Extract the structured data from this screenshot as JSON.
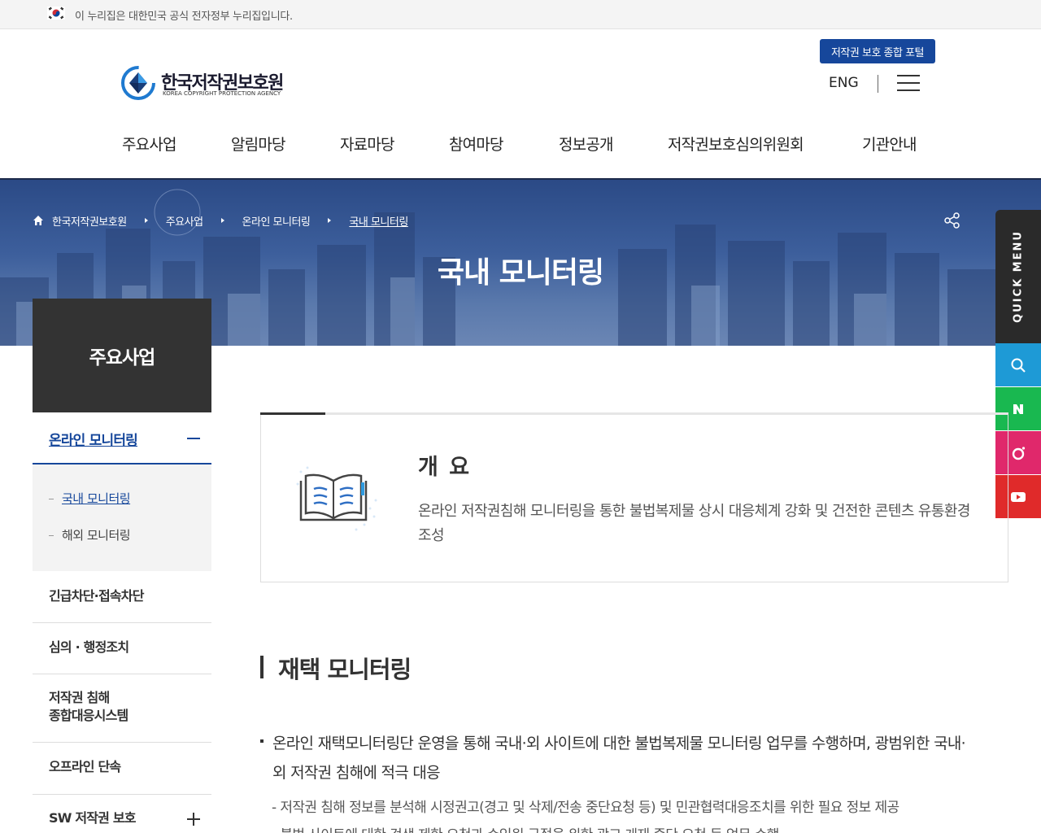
{
  "gov_banner": {
    "text": "이 누리집은 대한민국 공식 전자정부 누리집입니다."
  },
  "header": {
    "logo_kr": "한국저작권보호원",
    "logo_en": "KOREA COPYRIGHT PROTECTION AGENCY",
    "portal_button": "저작권 보호 종합 포털",
    "eng_link": "ENG"
  },
  "gnb": [
    "주요사업",
    "알림마당",
    "자료마당",
    "참여마당",
    "정보공개",
    "저작권보호심의위원회",
    "기관안내"
  ],
  "breadcrumb": [
    "한국저작권보호원",
    "주요사업",
    "온라인 모니터링",
    "국내 모니터링"
  ],
  "hero": {
    "title": "국내 모니터링"
  },
  "quick_menu": {
    "label": "QUICK MENU",
    "buttons": [
      "search-icon",
      "naver-blog-icon",
      "instagram-icon",
      "youtube-icon"
    ],
    "colors": [
      "#1e9ad6",
      "#19b850",
      "#e0286b",
      "#e02a2a"
    ]
  },
  "lnb": {
    "title": "주요사업",
    "active": "온라인 모니터링",
    "sub_items": [
      "국내 모니터링",
      "해외 모니터링"
    ],
    "items": [
      "긴급차단·접속차단",
      "심의 · 행정조치",
      "저작권 침해\n종합대응시스템",
      "오프라인 단속",
      "SW 저작권 보호"
    ]
  },
  "overview": {
    "title": "개 요",
    "desc": "온라인 저작권침해 모니터링을 통한 불법복제물 상시 대응체계 강화 및 건전한 콘텐츠 유통환경 조성"
  },
  "section": {
    "title": "재택 모니터링",
    "bullet": "온라인 재택모니터링단 운영을 통해 국내·외 사이트에 대한 불법복제물 모니터링 업무를 수행하며, 광범위한 국내·외 저작권 침해에 적극 대응",
    "sub1": "- 저작권 침해 정보를 분석해 시정권고(경고 및 삭제/전송 중단요청 등) 및 민관협력대응조치를 위한 필요 정보 제공",
    "sub2": "- 불법 사이트에 대한 검색 제한 요청과 수익원 근절을 위한 광고 게재 중단 요청 등 업무 수행"
  },
  "colors": {
    "brand": "#16479b",
    "dark": "#333333"
  }
}
